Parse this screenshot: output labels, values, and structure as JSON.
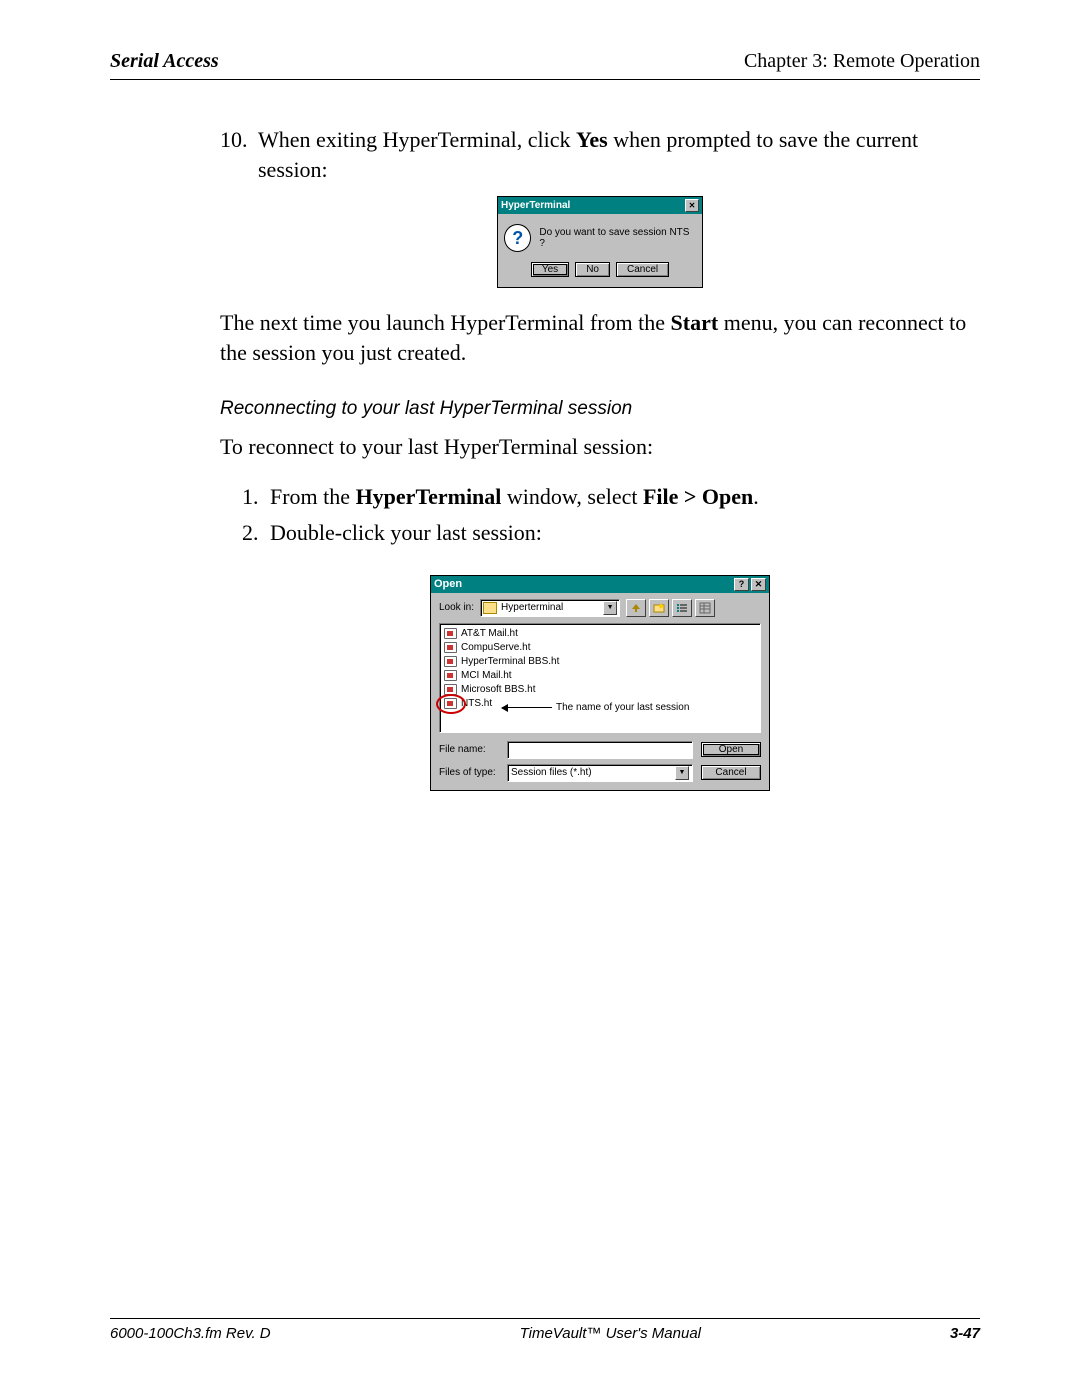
{
  "header": {
    "left": "Serial Access",
    "right": "Chapter 3: Remote Operation"
  },
  "step10": {
    "num": "10.",
    "text_a": "When exiting HyperTerminal, click ",
    "text_bold": "Yes",
    "text_b": " when prompted to save the current session:"
  },
  "dialog1": {
    "title": "HyperTerminal",
    "message": "Do you want to save session NTS ?",
    "buttons": {
      "yes": "Yes",
      "no": "No",
      "cancel": "Cancel"
    }
  },
  "para2": {
    "a": "The next time you launch HyperTerminal from the ",
    "bold": "Start",
    "b": " menu, you can reconnect to the session you just created."
  },
  "subhead": "Reconnecting to your last HyperTerminal session",
  "intro2": "To reconnect to your last HyperTerminal session:",
  "steps2": {
    "s1": {
      "n": "1.",
      "a": "From the ",
      "b1": "HyperTerminal",
      "mid": " window, select ",
      "b2": "File > Open",
      "end": "."
    },
    "s2": {
      "n": "2.",
      "t": "Double-click your last session:"
    }
  },
  "dialog2": {
    "title": "Open",
    "lookin_label": "Look in:",
    "lookin_value": "Hyperterminal",
    "files": [
      "AT&T Mail.ht",
      "CompuServe.ht",
      "HyperTerminal BBS.ht",
      "MCI Mail.ht",
      "Microsoft BBS.ht",
      "NTS.ht"
    ],
    "annotation": "The name of your last session",
    "filename_label": "File name:",
    "filename_value": "",
    "filetype_label": "Files of type:",
    "filetype_value": "Session files (*.ht)",
    "open_btn": "Open",
    "cancel_btn": "Cancel"
  },
  "footer": {
    "left": "6000-100Ch3.fm  Rev. D",
    "center": "TimeVault™ User's Manual",
    "right": "3-47"
  }
}
